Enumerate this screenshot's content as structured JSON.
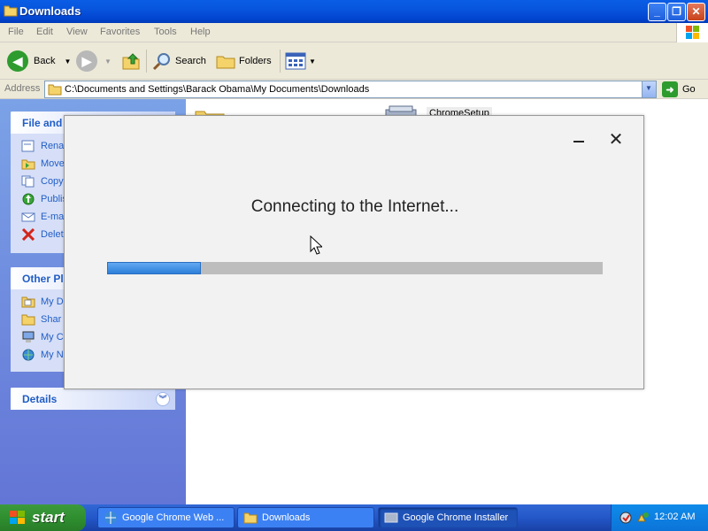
{
  "window": {
    "title": "Downloads",
    "menu": [
      "File",
      "Edit",
      "View",
      "Favorites",
      "Tools",
      "Help"
    ],
    "toolbar": {
      "back_label": "Back",
      "search_label": "Search",
      "folders_label": "Folders"
    },
    "address": {
      "label": "Address",
      "value": "C:\\Documents and Settings\\Barack Obama\\My Documents\\Downloads",
      "go_label": "Go"
    },
    "file_tasks": {
      "title": "File and",
      "items": [
        "Rena",
        "Move",
        "Copy",
        "Publis",
        "E-ma",
        "Delet"
      ]
    },
    "other_places": {
      "title": "Other Pl",
      "items": [
        "My D",
        "Shar",
        "My C",
        "My N"
      ]
    },
    "details": {
      "title": "Details"
    },
    "files": [
      {
        "name": "ChromeSetup"
      }
    ]
  },
  "installer": {
    "message": "Connecting to the Internet...",
    "progress_fraction": 0.19
  },
  "taskbar": {
    "start_label": "start",
    "tasks": [
      {
        "label": "Google Chrome Web ..."
      },
      {
        "label": "Downloads"
      },
      {
        "label": "Google Chrome Installer"
      }
    ],
    "clock": "12:02 AM"
  }
}
